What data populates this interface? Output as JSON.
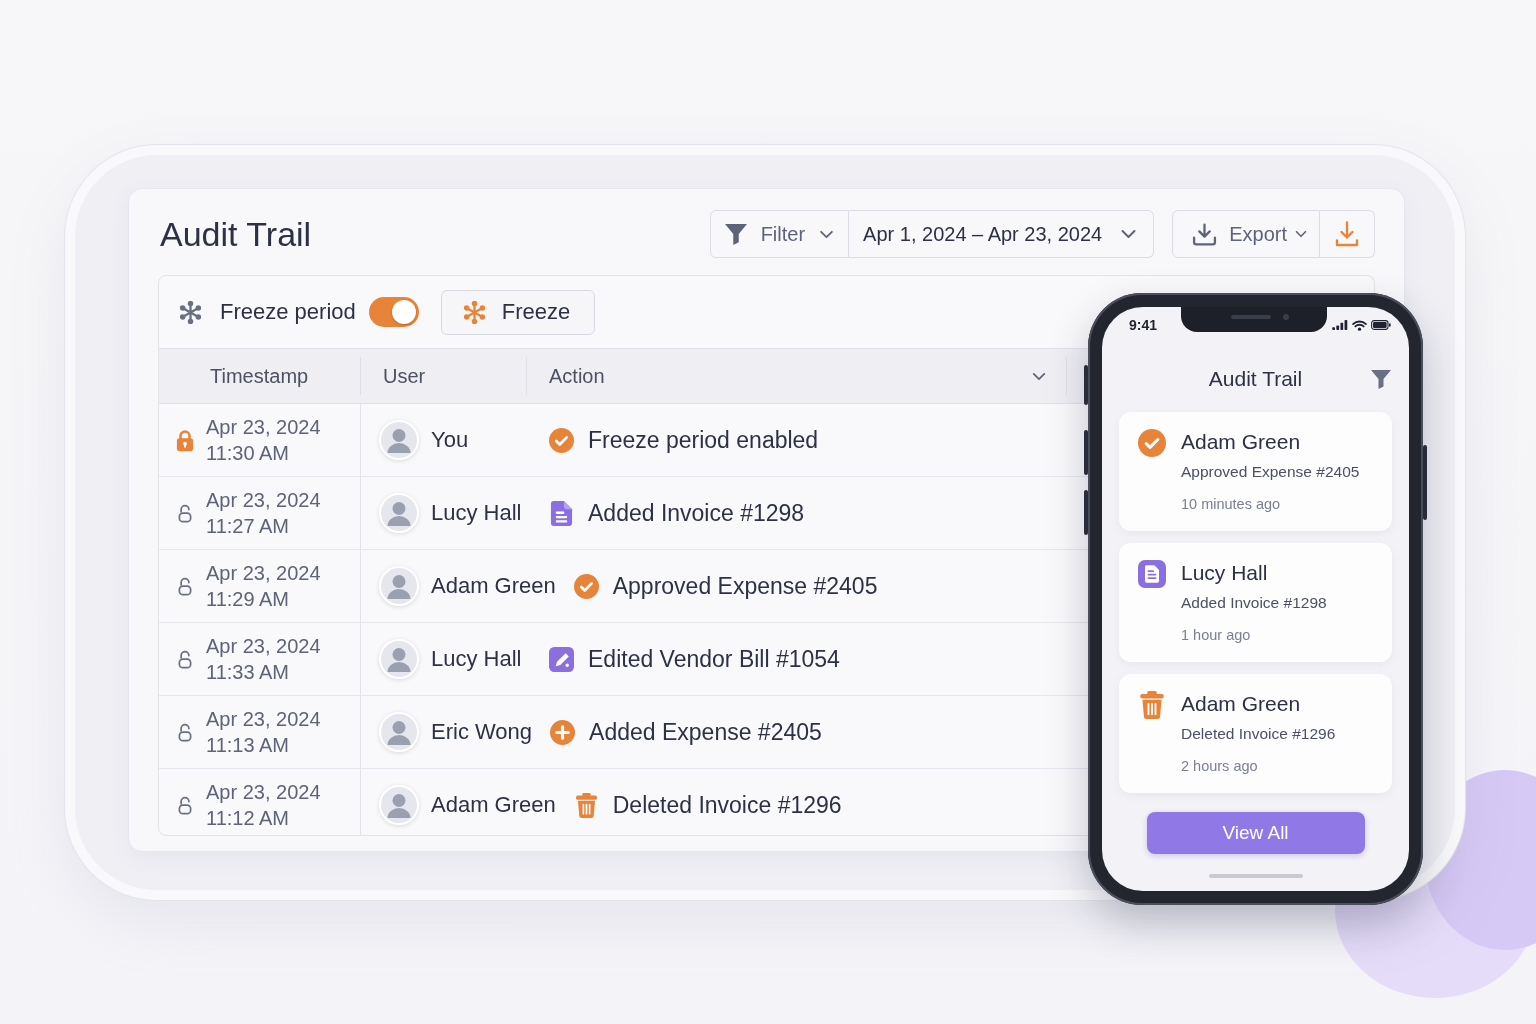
{
  "title": "Audit Trail",
  "toolbar": {
    "filter_label": "Filter",
    "date_range": "Apr 1, 2024 – Apr 23, 2024",
    "export_label": "Export"
  },
  "freeze_bar": {
    "toggle": {
      "label": "Freeze period",
      "on": true
    },
    "button": "Freeze"
  },
  "table": {
    "columns": [
      "Timestamp",
      "User",
      "Action"
    ],
    "rows": [
      {
        "locked": true,
        "date": "Apr 23, 2024",
        "time": "11:30 AM",
        "user": "You",
        "kind": "check",
        "action": "Freeze period enabled"
      },
      {
        "locked": false,
        "date": "Apr 23, 2024",
        "time": "11:27 AM",
        "user": "Lucy Hall",
        "kind": "document",
        "action": "Added Invoice #1298"
      },
      {
        "locked": false,
        "date": "Apr 23, 2024",
        "time": "11:29 AM",
        "user": "Adam Green",
        "kind": "check",
        "action": "Approved Expense #2405"
      },
      {
        "locked": false,
        "date": "Apr 23, 2024",
        "time": "11:33 AM",
        "user": "Lucy Hall",
        "kind": "edit",
        "action": "Edited Vendor Bill #1054"
      },
      {
        "locked": false,
        "date": "Apr 23, 2024",
        "time": "11:13 AM",
        "user": "Eric Wong",
        "kind": "plus",
        "action": "Added Expense #2405"
      },
      {
        "locked": false,
        "date": "Apr 23, 2024",
        "time": "11:12 AM",
        "user": "Adam Green",
        "kind": "trash",
        "action": "Deleted Invoice #1296"
      }
    ]
  },
  "phone": {
    "time": "9:41",
    "title": "Audit Trail",
    "cards": [
      {
        "kind": "check",
        "name": "Adam Green",
        "action": "Approved Expense #2405",
        "ago": "10 minutes ago"
      },
      {
        "kind": "document",
        "name": "Lucy Hall",
        "action": "Added Invoice #1298",
        "ago": "1 hour ago"
      },
      {
        "kind": "trash",
        "name": "Adam Green",
        "action": "Deleted Invoice #1296",
        "ago": "2 hours ago"
      }
    ],
    "button": "View All"
  }
}
